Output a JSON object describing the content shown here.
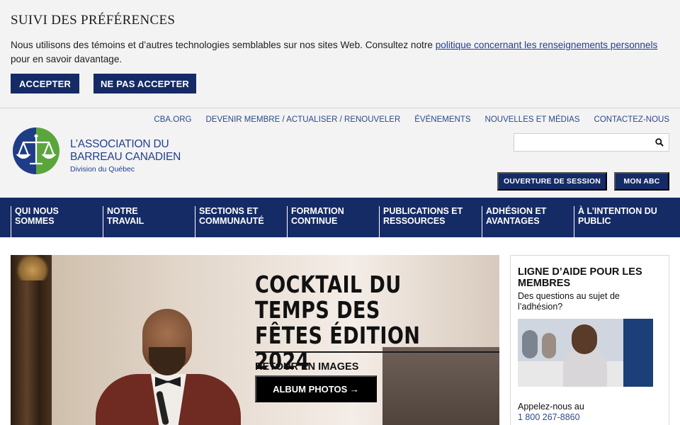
{
  "cookie_banner": {
    "title": "SUIVI DES PRÉFÉRENCES",
    "text_before": "Nous utilisons des témoins et d’autres technologies semblables sur nos sites Web. Consultez notre ",
    "link_text": "politique concernant les renseignements personnels",
    "text_after": " pour en savoir davantage.",
    "accept_label": "ACCEPTER",
    "decline_label": "NE PAS ACCEPTER"
  },
  "utility_nav": {
    "items": [
      {
        "label": "CBA.ORG"
      },
      {
        "label": "DEVENIR MEMBRE / ACTUALISER / RENOUVELER"
      },
      {
        "label": "ÉVÉNEMENTS"
      },
      {
        "label": "NOUVELLES ET MÉDIAS"
      },
      {
        "label": "CONTACTEZ-NOUS"
      }
    ]
  },
  "logo": {
    "line1": "L’ASSOCIATION DU",
    "line2": "BARREAU CANADIEN",
    "line3": "Division du Québec",
    "icon": "scales-of-justice-icon"
  },
  "search": {
    "placeholder": "",
    "icon": "search-icon"
  },
  "account": {
    "login_label": "OUVERTURE DE SESSION",
    "my_abc_label": "MON ABC"
  },
  "main_nav": {
    "items": [
      {
        "label": "QUI NOUS SOMMES"
      },
      {
        "label": "NOTRE TRAVAIL"
      },
      {
        "label": "SECTIONS ET COMMUNAUTÉ"
      },
      {
        "label": "FORMATION CONTINUE"
      },
      {
        "label": "PUBLICATIONS ET RESSOURCES"
      },
      {
        "label": "ADHÉSION ET AVANTAGES"
      },
      {
        "label": "À L’INTENTION DU PUBLIC"
      }
    ]
  },
  "hero": {
    "title": "COCKTAIL DU TEMPS DES FÊTES ÉDITION 2024",
    "subtitle": "RETOUR EN IMAGES",
    "button_label": "ALBUM PHOTOS →"
  },
  "helpline": {
    "title": "LIGNE D’AIDE POUR LES MEMBRES",
    "description": "Des questions au sujet de l’adhésion?",
    "call_text": "Appelez-nous au",
    "phone": "1 800 267-8860"
  },
  "colors": {
    "navy": "#152b66",
    "link_blue": "#2b4a8a",
    "logo_green": "#5aa63c",
    "banner_bg": "#f3f3f3"
  }
}
